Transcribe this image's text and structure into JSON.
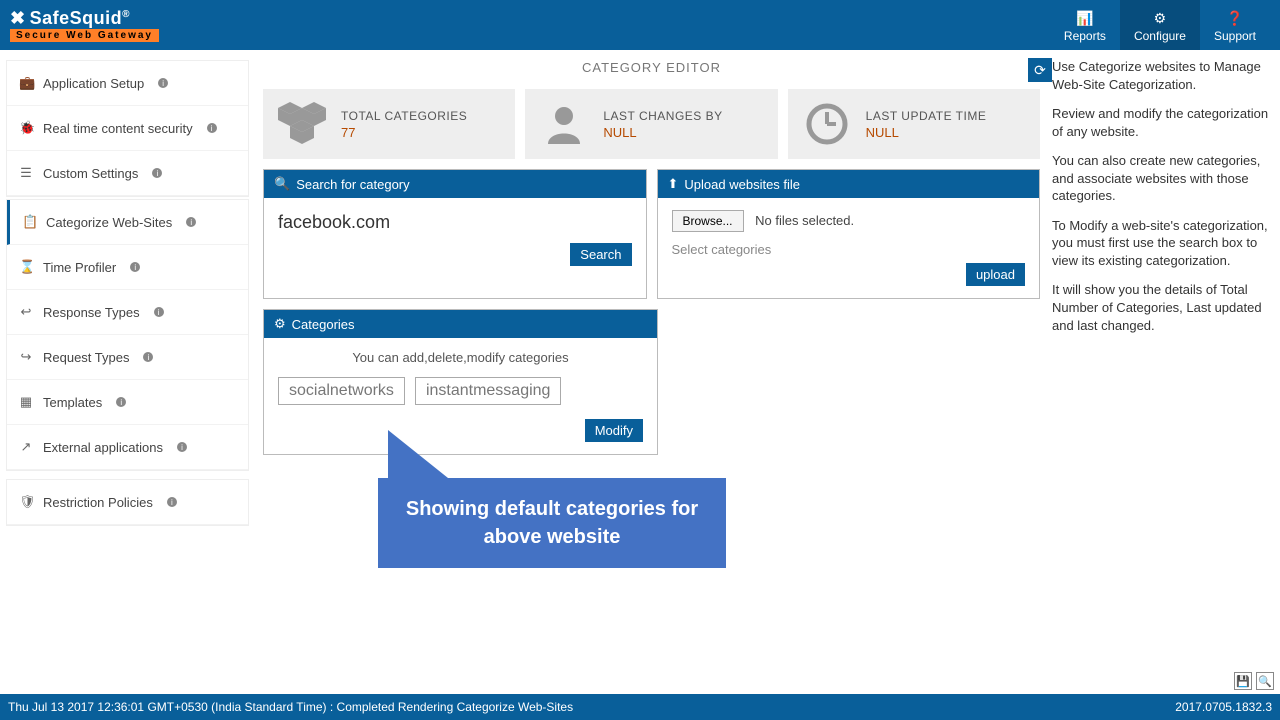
{
  "brand": {
    "name": "SafeSquid",
    "tagline": "Secure Web Gateway"
  },
  "topnav": {
    "reports": "Reports",
    "configure": "Configure",
    "support": "Support"
  },
  "sidebar": {
    "items": [
      {
        "label": "Application Setup"
      },
      {
        "label": "Real time content security"
      },
      {
        "label": "Custom Settings"
      },
      {
        "label": "Categorize Web-Sites"
      },
      {
        "label": "Time Profiler"
      },
      {
        "label": "Response Types"
      },
      {
        "label": "Request Types"
      },
      {
        "label": "Templates"
      },
      {
        "label": "External applications"
      },
      {
        "label": "Restriction Policies"
      }
    ]
  },
  "page": {
    "title": "CATEGORY EDITOR"
  },
  "stats": {
    "total_label": "TOTAL CATEGORIES",
    "total_value": "77",
    "changed_label": "LAST CHANGES BY",
    "changed_value": "NULL",
    "updated_label": "LAST UPDATE TIME",
    "updated_value": "NULL"
  },
  "search_panel": {
    "title": "Search for category",
    "value": "facebook.com",
    "button": "Search"
  },
  "upload_panel": {
    "title": "Upload websites file",
    "browse": "Browse...",
    "nofiles": "No files selected.",
    "selectcat": "Select categories",
    "upload": "upload"
  },
  "categories_panel": {
    "title": "Categories",
    "desc": "You can add,delete,modify categories",
    "chips": [
      "socialnetworks",
      "instantmessaging"
    ],
    "modify": "Modify"
  },
  "help": {
    "p1": "Use Categorize websites to Manage Web-Site Categorization.",
    "p2": "Review and modify the categorization of any website.",
    "p3": "You can also create new categories, and associate websites with those categories.",
    "p4": "To Modify a web-site's categorization, you must first use the search box to view its existing categorization.",
    "p5": "It will show you the details of Total Number of Categories, Last updated and last changed."
  },
  "footer": {
    "status": "Thu Jul 13 2017 12:36:01 GMT+0530 (India Standard Time) : Completed Rendering Categorize Web-Sites",
    "version": "2017.0705.1832.3"
  },
  "callout": {
    "text": "Showing default categories for above website"
  }
}
